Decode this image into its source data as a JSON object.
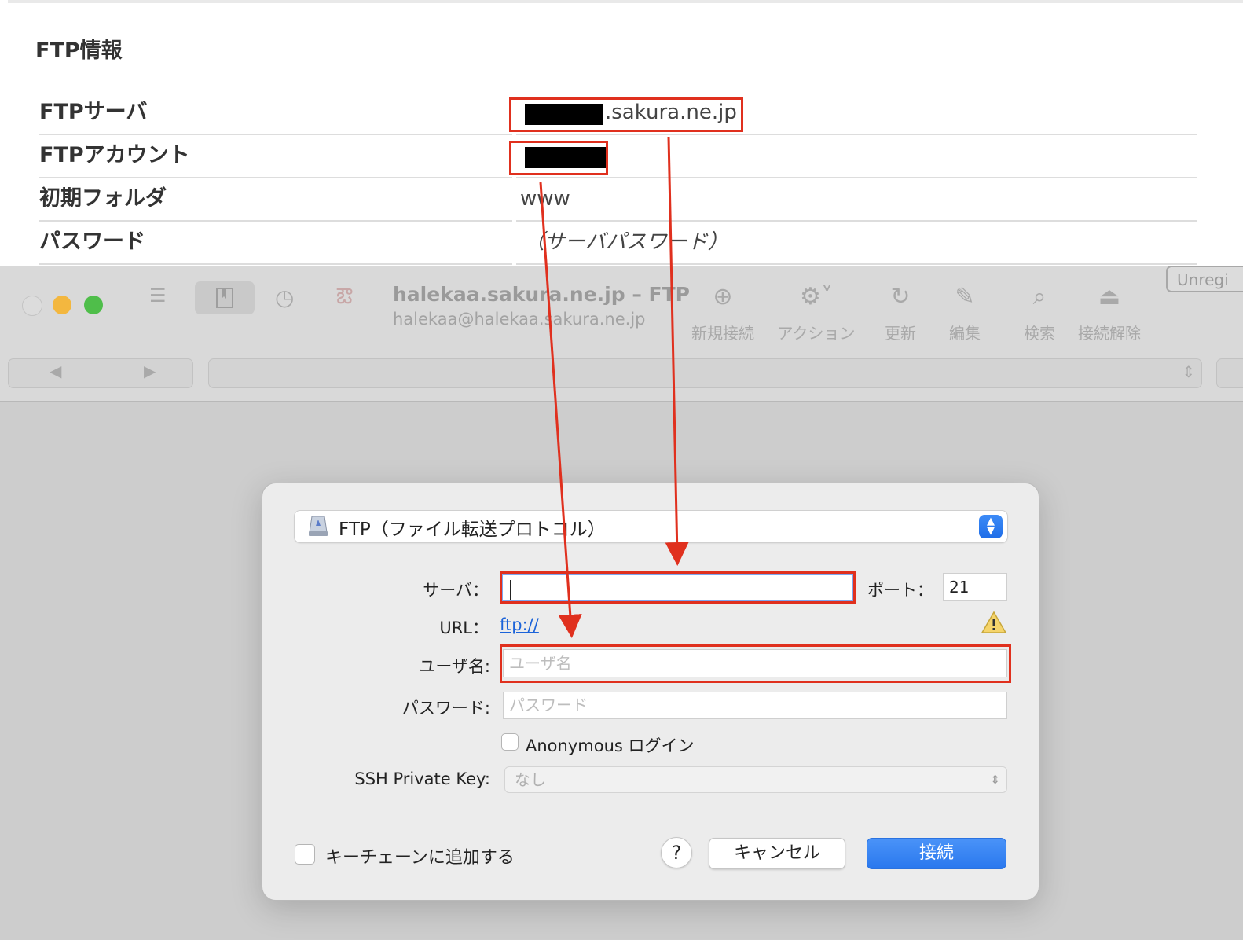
{
  "info": {
    "title": "FTP情報",
    "rows": [
      {
        "label": "FTPサーバ",
        "value": ".sakura.ne.jp"
      },
      {
        "label": "FTPアカウント",
        "value": ""
      },
      {
        "label": "初期フォルダ",
        "value": "www"
      },
      {
        "label": "パスワード",
        "value": "（サーバパスワード）"
      }
    ]
  },
  "window": {
    "title": "halekaa.sakura.ne.jp – FTP",
    "subtitle": "halekaa@halekaa.sakura.ne.jp",
    "unregistered": "Unregi",
    "toolbar": {
      "new_connection": "新規接続",
      "action": "アクション",
      "refresh": "更新",
      "edit": "編集",
      "search": "検索",
      "disconnect": "接続解除"
    }
  },
  "dialog": {
    "protocol": "FTP（ファイル転送プロトコル）",
    "server_label": "サーバ：",
    "server_value": "",
    "port_label": "ポート：",
    "port_value": "21",
    "url_label": "URL：",
    "url_value": "ftp://",
    "username_label": "ユーザ名:",
    "username_placeholder": "ユーザ名",
    "password_label": "パスワード:",
    "password_placeholder": "パスワード",
    "anonymous_label": "Anonymous ログイン",
    "ssh_key_label": "SSH Private Key:",
    "ssh_key_value": "なし",
    "keychain_label": "キーチェーンに追加する",
    "help": "?",
    "cancel": "キャンセル",
    "connect": "接続"
  },
  "colors": {
    "annotation_red": "#e0301e",
    "accent_blue": "#2a78ee",
    "link_blue": "#1b63d9"
  }
}
